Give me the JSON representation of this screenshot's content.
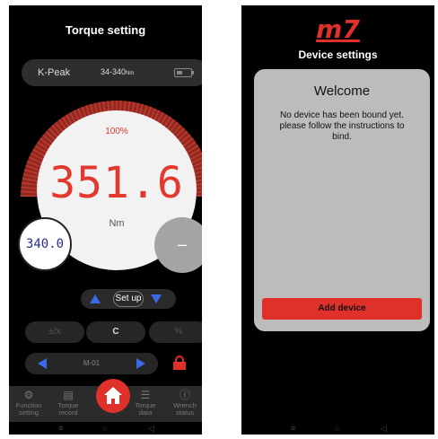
{
  "left_screen": {
    "title": "Torque setting",
    "mode_bar": {
      "mode": "K-Peak",
      "range": "34-340",
      "range_unit": "Nm",
      "battery_icon": "battery-icon"
    },
    "dial": {
      "percent_label": "100%",
      "reading": "351.6",
      "unit": "Nm"
    },
    "set_value": "340.0",
    "minus_label": "–",
    "setup": {
      "label": "Set up",
      "up_icon": "triangle-up-icon",
      "down_icon": "triangle-down-icon"
    },
    "row3": {
      "left": "±/x",
      "center": "C",
      "right": "%"
    },
    "memory": {
      "label": "M-01",
      "prev_icon": "triangle-left-icon",
      "next_icon": "triangle-right-icon"
    },
    "lock_icon": "lock-icon",
    "tabs": [
      {
        "label1": "Function",
        "label2": "setting",
        "icon": "gear-icon"
      },
      {
        "label1": "Torque",
        "label2": "record",
        "icon": "record-icon"
      },
      {
        "label1": "Torque",
        "label2": "data",
        "icon": "sliders-icon"
      },
      {
        "label1": "Wrench",
        "label2": "status",
        "icon": "info-icon"
      }
    ],
    "home_icon": "home-icon",
    "nav": {
      "menu": "≡",
      "home": "○",
      "back": "◁"
    },
    "colors": {
      "accent": "#e0302a",
      "blue": "#3a6ae6"
    }
  },
  "right_screen": {
    "logo": "m7",
    "title": "Device settings",
    "welcome": "Welcome",
    "message_line1": "No device has been bound yet.",
    "message_line2": "please follow the instructions to",
    "message_line3": "bind.",
    "add_device": "Add device",
    "nav": {
      "menu": "≡",
      "home": "○",
      "back": "◁"
    }
  }
}
